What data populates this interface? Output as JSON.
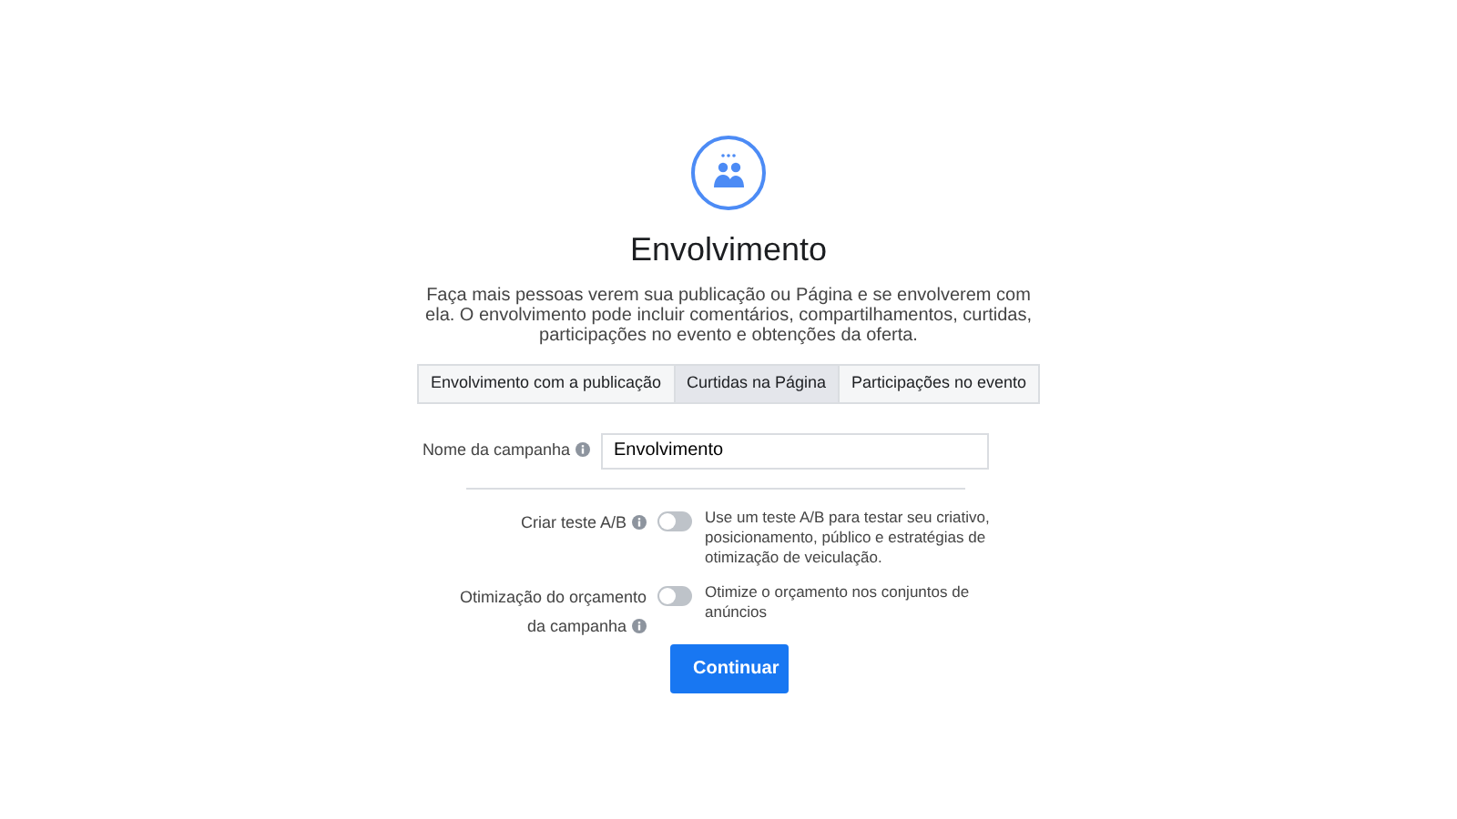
{
  "title": "Envolvimento",
  "description": "Faça mais pessoas verem sua publicação ou Página e se envolverem com ela. O envolvimento pode incluir comentários, compartilhamentos, curtidas, participações no evento e obtenções da oferta.",
  "tabs": [
    {
      "label": "Envolvimento com a publicação",
      "selected": false
    },
    {
      "label": "Curtidas na Página",
      "selected": true
    },
    {
      "label": "Participações no evento",
      "selected": false
    }
  ],
  "campaign_name": {
    "label": "Nome da campanha",
    "value": "Envolvimento"
  },
  "toggles": [
    {
      "label": "Criar teste A/B",
      "on": false,
      "description": "Use um teste A/B para testar seu criativo, posicionamento, público e estratégias de otimização de veiculação."
    },
    {
      "label": "Otimização do orçamento da campanha",
      "on": false,
      "description": "Otimize o orçamento nos conjuntos de anúncios"
    }
  ],
  "button": "Continuar"
}
